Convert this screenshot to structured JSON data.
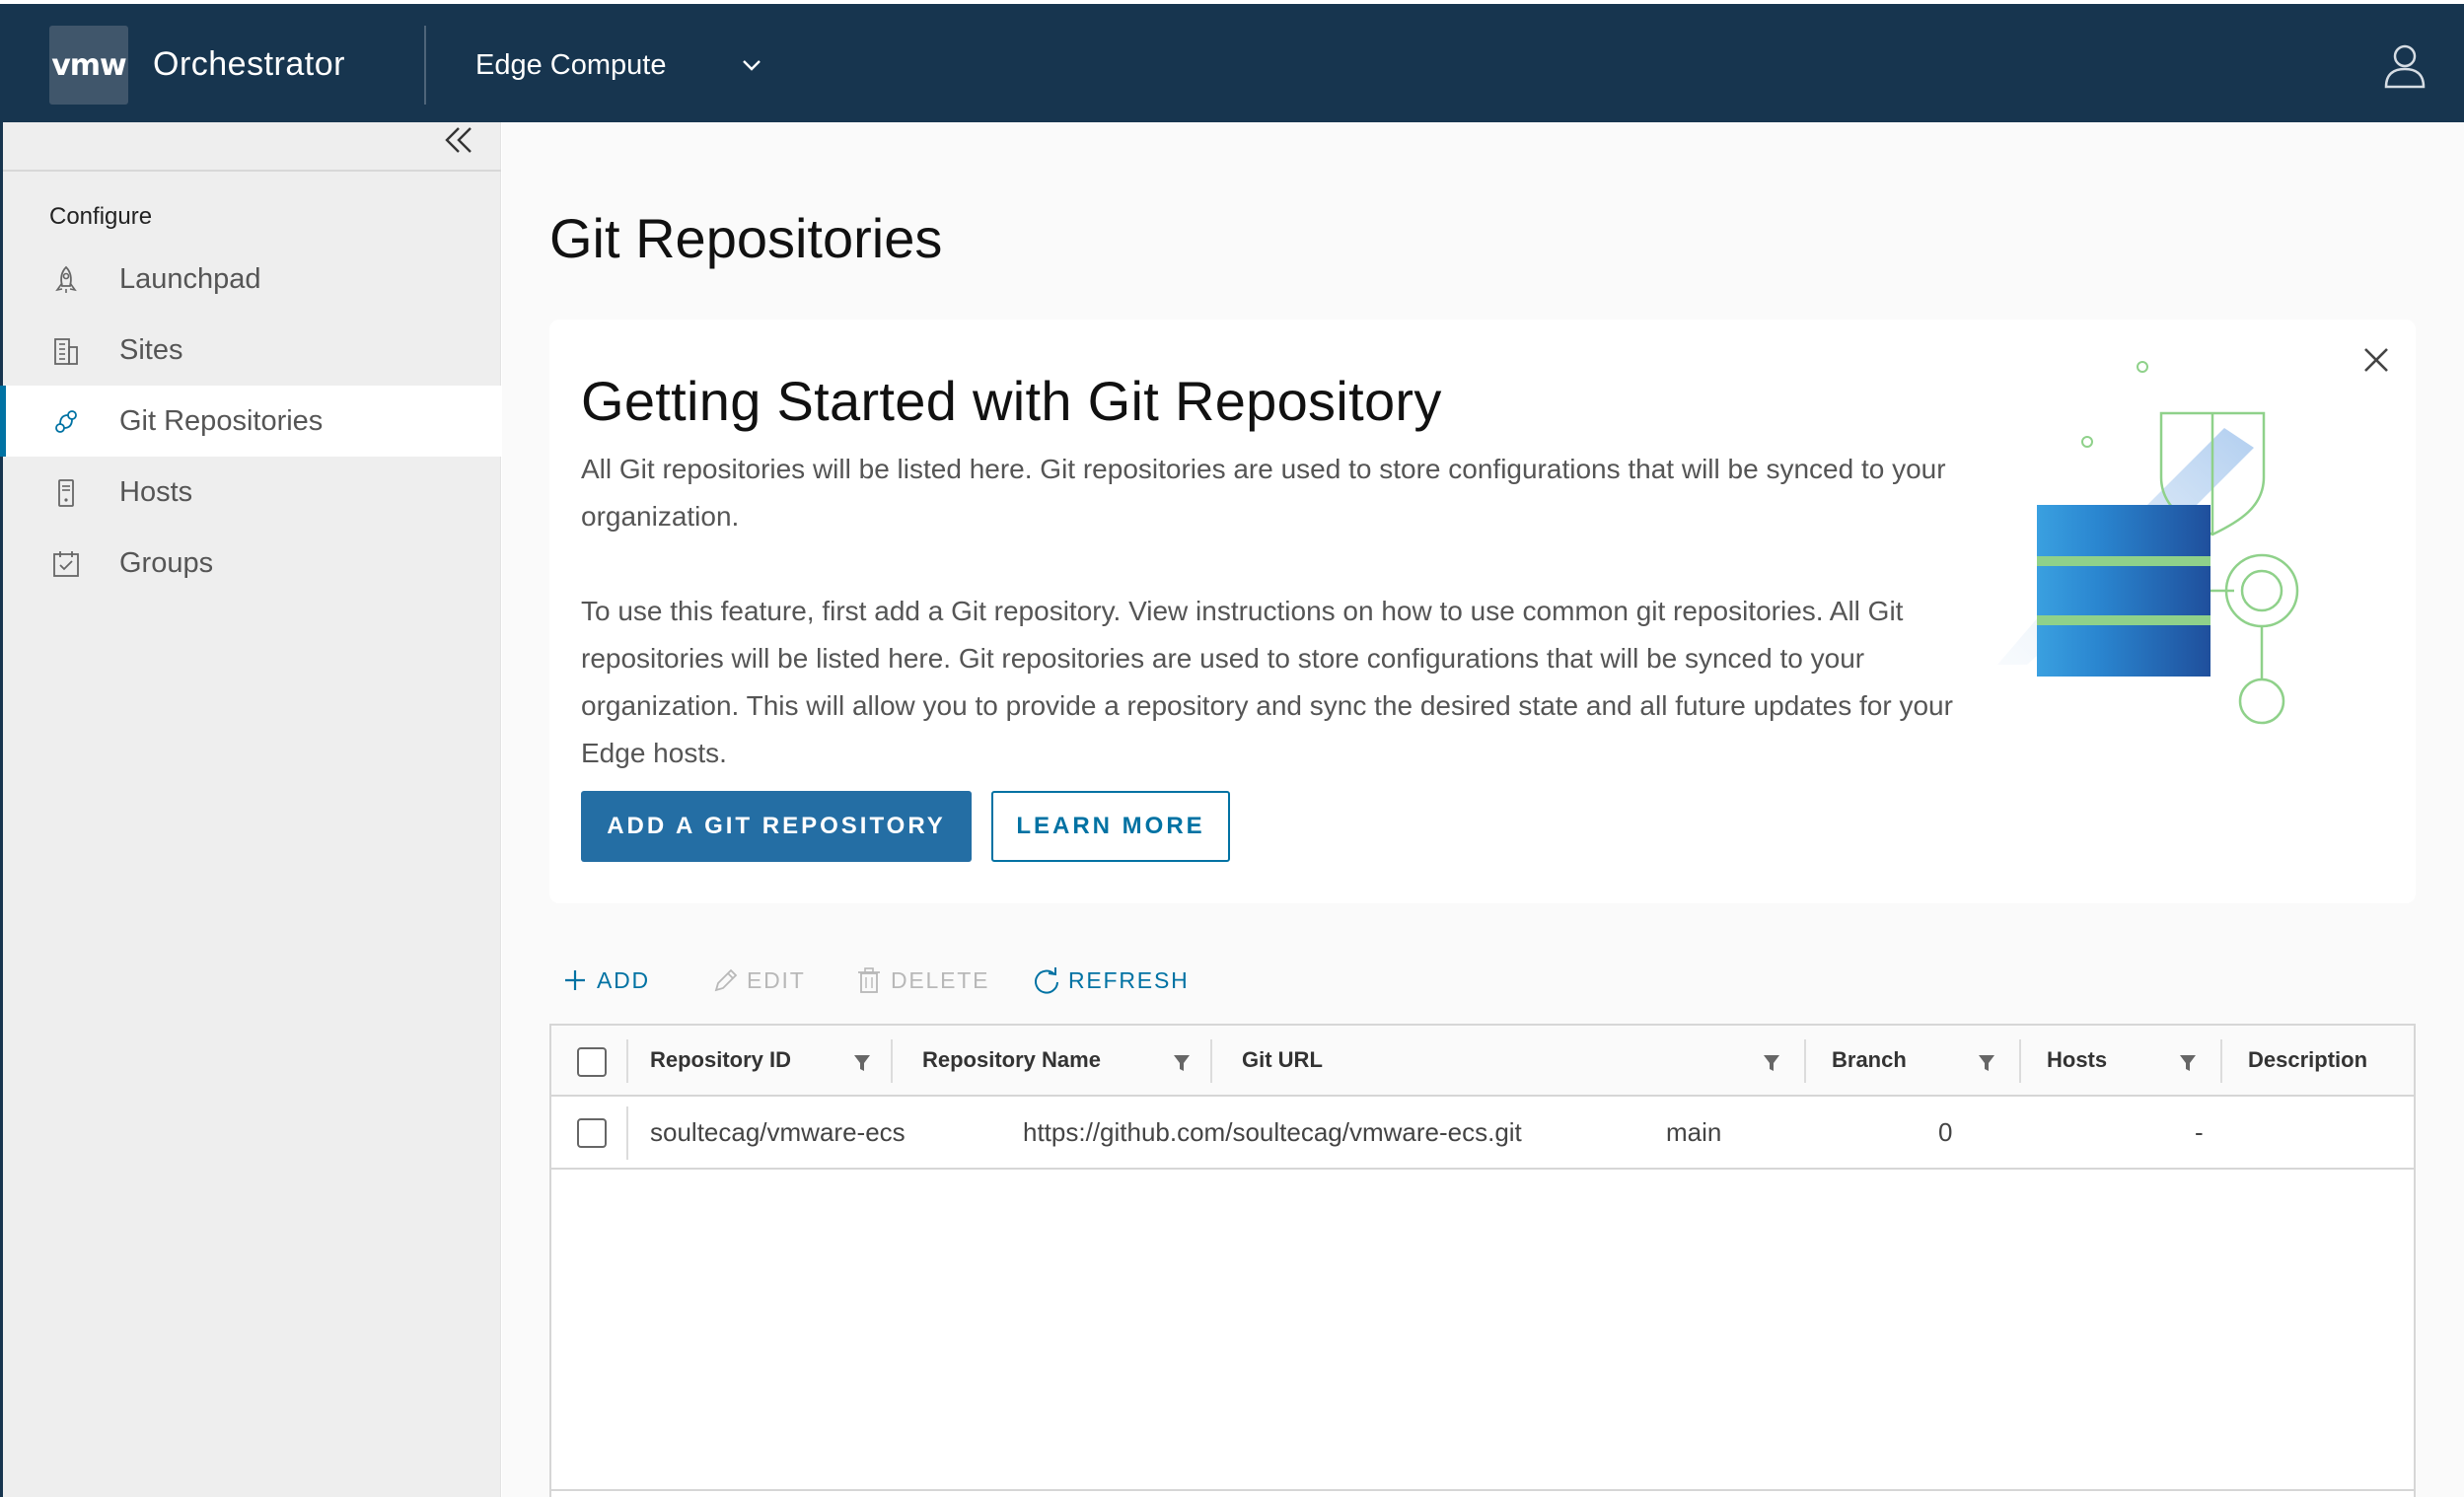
{
  "header": {
    "logo_text": "vmw",
    "app_title": "Orchestrator",
    "context": "Edge Compute",
    "user_icon": "user-icon"
  },
  "sidebar": {
    "section_label": "Configure",
    "items": [
      {
        "label": "Launchpad",
        "icon": "rocket-icon"
      },
      {
        "label": "Sites",
        "icon": "building-icon"
      },
      {
        "label": "Git Repositories",
        "icon": "git-link-icon",
        "active": true
      },
      {
        "label": "Hosts",
        "icon": "server-icon"
      },
      {
        "label": "Groups",
        "icon": "calendar-check-icon"
      }
    ]
  },
  "main": {
    "page_title": "Git Repositories",
    "card": {
      "title": "Getting Started with Git Repository",
      "paragraph1": "All Git repositories will be listed here. Git repositories are used to store configurations that will be synced to your organization.",
      "paragraph2": "To use this feature, first add a Git repository. View instructions on how to use common git repositories. All Git repositories will be listed here. Git repositories are used to store configurations that will be synced to your organization. This will allow you to provide a repository and sync the desired state and all future updates for your Edge hosts.",
      "primary_button": "ADD A GIT REPOSITORY",
      "secondary_button": "LEARN MORE"
    },
    "actions": {
      "add": "ADD",
      "edit": "EDIT",
      "delete": "DELETE",
      "refresh": "REFRESH"
    },
    "table": {
      "columns": [
        "Repository ID",
        "Repository Name",
        "Git URL",
        "Branch",
        "Hosts",
        "Description"
      ],
      "rows": [
        {
          "repository_id": "soultecag/vmware-ecs",
          "repository_name": "https://github.com/soultecag/vmware-ecs.git",
          "git_url": "main",
          "branch": "0",
          "hosts": "-",
          "description": ""
        }
      ]
    }
  },
  "colors": {
    "header_bg": "#17354f",
    "accent": "#0072a3",
    "primary_button": "#246ea4",
    "sidebar_bg": "#eeeeee",
    "illustration_green": "#8fd18a"
  }
}
